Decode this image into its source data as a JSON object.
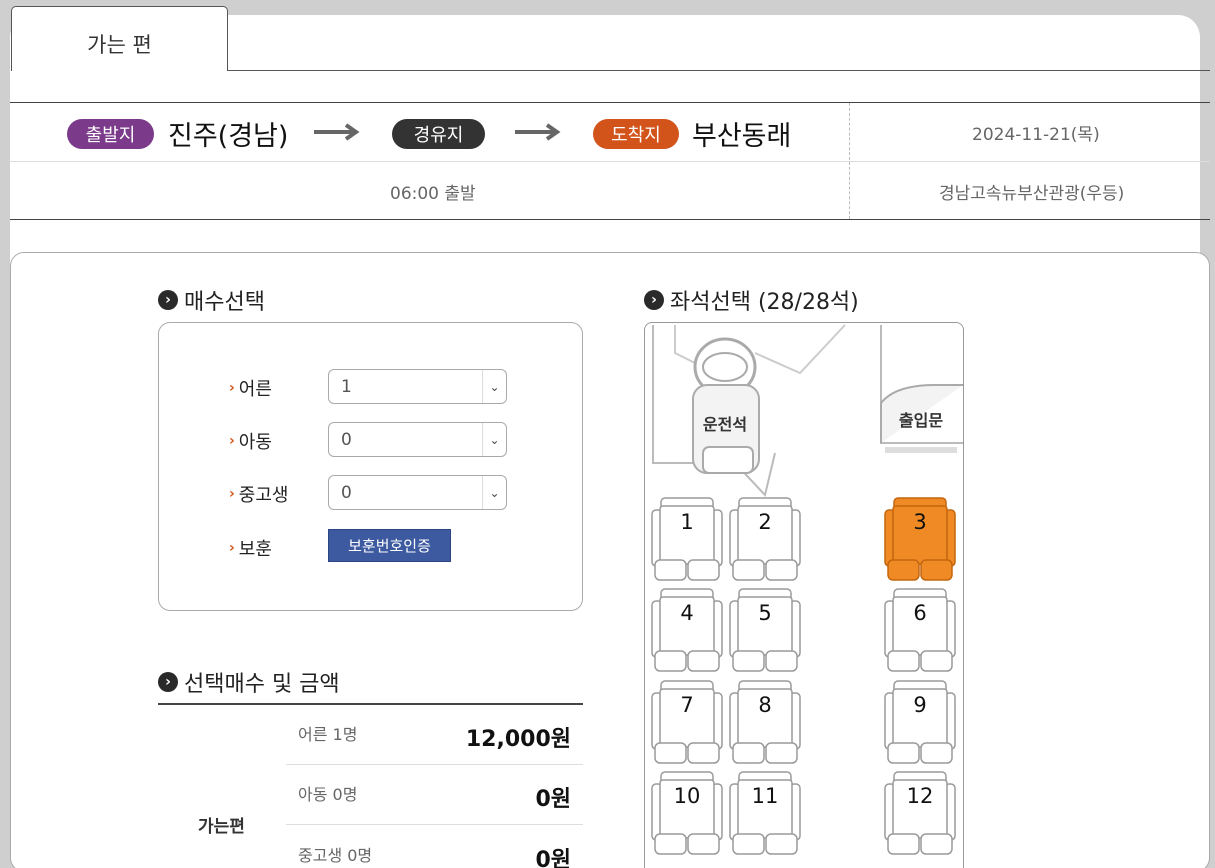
{
  "tab": {
    "label": "가는 편"
  },
  "route": {
    "departure_badge": "출발지",
    "departure": "진주(경남)",
    "via_badge": "경유지",
    "arrival_badge": "도착지",
    "arrival": "부산동래",
    "date": "2024-11-21(목)",
    "time": "06:00 출발",
    "company": "경남고속뉴부산관광(우등)",
    "colors": {
      "departure": "#7b3a8a",
      "via": "#333333",
      "arrival": "#d2541a"
    }
  },
  "quantity": {
    "title": "매수선택",
    "adult_label": "어른",
    "adult_value": "1",
    "child_label": "아동",
    "child_value": "0",
    "student_label": "중고생",
    "student_value": "0",
    "veteran_label": "보훈",
    "veteran_button": "보훈번호인증"
  },
  "price": {
    "title": "선택매수 및 금액",
    "side_label": "가는편",
    "rows": [
      {
        "label": "어른 1명",
        "value": "12,000원"
      },
      {
        "label": "아동 0명",
        "value": "0원"
      },
      {
        "label": "중고생 0명",
        "value": "0원"
      }
    ]
  },
  "seats": {
    "title": "좌석선택 (28/28석)",
    "driver_label": "운전석",
    "door_label": "출입문",
    "selected_color": "#f08a24",
    "list": [
      {
        "num": "1",
        "selected": false
      },
      {
        "num": "2",
        "selected": false
      },
      {
        "num": "3",
        "selected": true
      },
      {
        "num": "4",
        "selected": false
      },
      {
        "num": "5",
        "selected": false
      },
      {
        "num": "6",
        "selected": false
      },
      {
        "num": "7",
        "selected": false
      },
      {
        "num": "8",
        "selected": false
      },
      {
        "num": "9",
        "selected": false
      },
      {
        "num": "10",
        "selected": false
      },
      {
        "num": "11",
        "selected": false
      },
      {
        "num": "12",
        "selected": false
      }
    ]
  }
}
